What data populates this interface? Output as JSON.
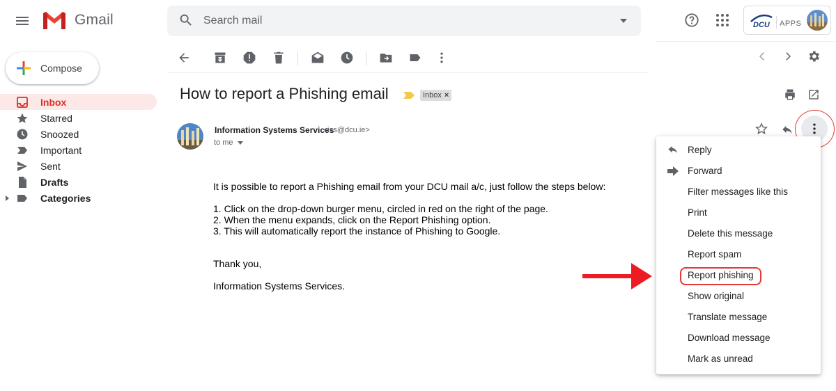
{
  "header": {
    "app_name": "Gmail",
    "search_placeholder": "Search mail",
    "account_apps_label": "APPS",
    "account_logo_text": "DCU"
  },
  "sidebar": {
    "compose_label": "Compose",
    "items": [
      {
        "label": "Inbox",
        "icon": "inbox-icon",
        "active": true
      },
      {
        "label": "Starred",
        "icon": "star-icon"
      },
      {
        "label": "Snoozed",
        "icon": "clock-icon"
      },
      {
        "label": "Important",
        "icon": "important-icon"
      },
      {
        "label": "Sent",
        "icon": "send-icon"
      },
      {
        "label": "Drafts",
        "icon": "draft-icon"
      },
      {
        "label": "Categories",
        "icon": "label-icon"
      }
    ]
  },
  "toolbar": {
    "icons": [
      "back-icon",
      "archive-icon",
      "spam-icon",
      "delete-icon",
      "mark-unread-icon",
      "snooze-icon",
      "move-to-icon",
      "labels-icon",
      "more-icon"
    ]
  },
  "email": {
    "subject": "How to report a Phishing email",
    "label": "Inbox",
    "sender_name": "Information Systems Services",
    "sender_email": "<iss@dcu.ie>",
    "recipient": "to me",
    "body": {
      "intro": "It is possible to report a Phishing email from your DCU mail a/c, just follow the steps below:",
      "steps": [
        "1. Click on the drop-down burger menu, circled in red on the right of the page.",
        "2. When the menu expands, click on the Report Phishing option.",
        "3. This will automatically report the instance of Phishing to Google."
      ],
      "closing": "Thank you,",
      "signature": "Information Systems Services."
    }
  },
  "message_menu": {
    "items": [
      {
        "label": "Reply",
        "icon": "reply-icon"
      },
      {
        "label": "Forward",
        "icon": "forward-icon"
      },
      {
        "label": "Filter messages like this"
      },
      {
        "label": "Print"
      },
      {
        "label": "Delete this message"
      },
      {
        "label": "Report spam"
      },
      {
        "label": "Report phishing",
        "highlighted": true
      },
      {
        "label": "Show original"
      },
      {
        "label": "Translate message"
      },
      {
        "label": "Download message"
      },
      {
        "label": "Mark as unread"
      }
    ]
  },
  "colors": {
    "accent_red": "#e53935",
    "inbox_active_bg": "#fce8e6",
    "inbox_active_text": "#d93025",
    "search_bg": "#f1f3f4"
  }
}
